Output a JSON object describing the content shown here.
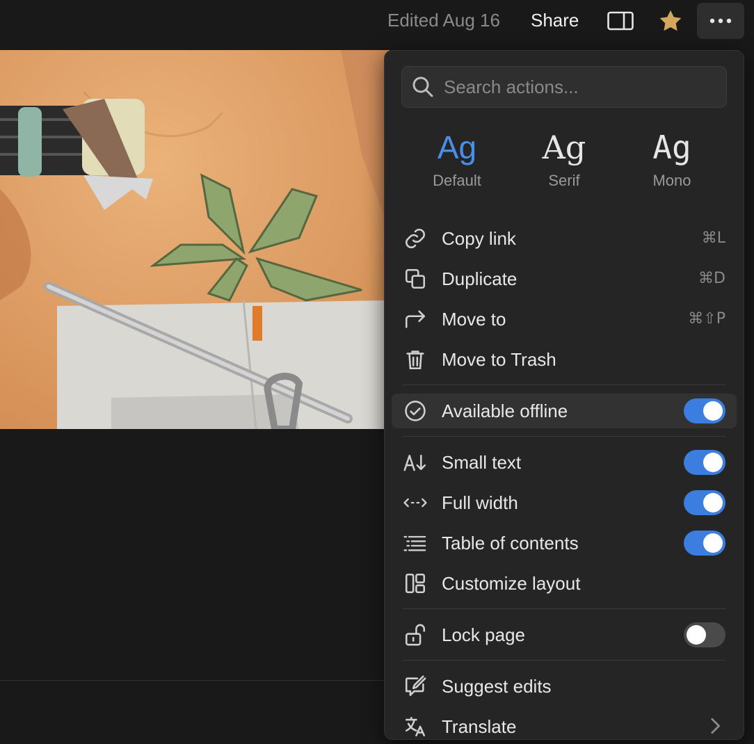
{
  "topbar": {
    "edited": "Edited Aug 16",
    "share": "Share"
  },
  "menu": {
    "search_placeholder": "Search actions...",
    "fonts": [
      {
        "sample": "Ag",
        "label": "Default",
        "selected": true
      },
      {
        "sample": "Ag",
        "label": "Serif"
      },
      {
        "sample": "Ag",
        "label": "Mono"
      }
    ],
    "items": {
      "copy_link": {
        "label": "Copy link",
        "shortcut": "⌘L"
      },
      "duplicate": {
        "label": "Duplicate",
        "shortcut": "⌘D"
      },
      "move_to": {
        "label": "Move to",
        "shortcut": "⌘⇧P"
      },
      "move_trash": {
        "label": "Move to Trash"
      },
      "offline": {
        "label": "Available offline",
        "toggle": true
      },
      "small_text": {
        "label": "Small text",
        "toggle": true
      },
      "full_width": {
        "label": "Full width",
        "toggle": true
      },
      "toc": {
        "label": "Table of contents",
        "toggle": true
      },
      "customize": {
        "label": "Customize layout"
      },
      "lock": {
        "label": "Lock page",
        "toggle": false
      },
      "suggest": {
        "label": "Suggest edits"
      },
      "translate": {
        "label": "Translate"
      }
    }
  },
  "colors": {
    "accent": "#3b7ee0",
    "star": "#d4a75c",
    "menu_bg": "#252525"
  }
}
